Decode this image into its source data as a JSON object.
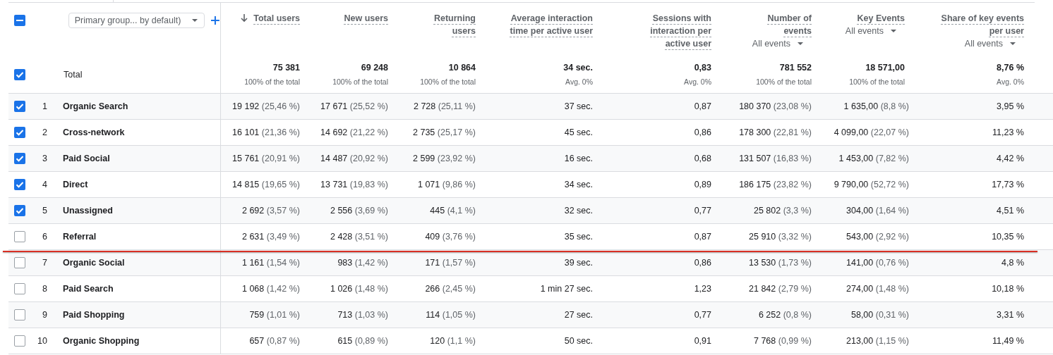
{
  "select_all": {
    "indeterminate": true
  },
  "group_selector": {
    "label": "Primary group... by default)"
  },
  "columns": [
    {
      "label": "Total users",
      "sorted": true
    },
    {
      "label": "New users",
      "sorted": false
    },
    {
      "label": "Returning users",
      "sorted": false
    },
    {
      "label": "Average interaction time per active user",
      "sorted": false
    },
    {
      "label": "Sessions with interaction per active user",
      "sorted": false
    },
    {
      "label": "Number of events",
      "sorted": false,
      "filter": "All events"
    },
    {
      "label": "Key Events",
      "sorted": false,
      "filter": "All events"
    },
    {
      "label": "Share of key events per user",
      "sorted": false,
      "filter": "All events"
    }
  ],
  "totals": {
    "label": "Total",
    "checked": true,
    "values": [
      {
        "value": "75 381",
        "note": "100% of the total"
      },
      {
        "value": "69 248",
        "note": "100% of the total"
      },
      {
        "value": "10 864",
        "note": "100% of the total"
      },
      {
        "value": "34 sec.",
        "note": "Avg. 0%"
      },
      {
        "value": "0,83",
        "note": "Avg. 0%"
      },
      {
        "value": "781 552",
        "note": "100% of the total"
      },
      {
        "value": "18 571,00",
        "note": "100% of the total"
      },
      {
        "value": "8,76 %",
        "note": "Avg. 0%"
      }
    ]
  },
  "rows": [
    {
      "index": "1",
      "name": "Organic Search",
      "checked": true,
      "annotated": false,
      "cells": [
        {
          "value": "19 192",
          "share": "(25,46 %)"
        },
        {
          "value": "17 671",
          "share": "(25,52 %)"
        },
        {
          "value": "2 728",
          "share": "(25,11 %)"
        },
        {
          "value": "37 sec."
        },
        {
          "value": "0,87"
        },
        {
          "value": "180 370",
          "share": "(23,08 %)"
        },
        {
          "value": "1 635,00",
          "share": "(8,8 %)"
        },
        {
          "value": "3,95 %"
        }
      ]
    },
    {
      "index": "2",
      "name": "Cross-network",
      "checked": true,
      "annotated": false,
      "cells": [
        {
          "value": "16 101",
          "share": "(21,36 %)"
        },
        {
          "value": "14 692",
          "share": "(21,22 %)"
        },
        {
          "value": "2 735",
          "share": "(25,17 %)"
        },
        {
          "value": "45 sec."
        },
        {
          "value": "0,86"
        },
        {
          "value": "178 300",
          "share": "(22,81 %)"
        },
        {
          "value": "4 099,00",
          "share": "(22,07 %)"
        },
        {
          "value": "11,23 %"
        }
      ]
    },
    {
      "index": "3",
      "name": "Paid Social",
      "checked": true,
      "annotated": false,
      "cells": [
        {
          "value": "15 761",
          "share": "(20,91 %)"
        },
        {
          "value": "14 487",
          "share": "(20,92 %)"
        },
        {
          "value": "2 599",
          "share": "(23,92 %)"
        },
        {
          "value": "16 sec."
        },
        {
          "value": "0,68"
        },
        {
          "value": "131 507",
          "share": "(16,83 %)"
        },
        {
          "value": "1 453,00",
          "share": "(7,82 %)"
        },
        {
          "value": "4,42 %"
        }
      ]
    },
    {
      "index": "4",
      "name": "Direct",
      "checked": true,
      "annotated": false,
      "cells": [
        {
          "value": "14 815",
          "share": "(19,65 %)"
        },
        {
          "value": "13 731",
          "share": "(19,83 %)"
        },
        {
          "value": "1 071",
          "share": "(9,86 %)"
        },
        {
          "value": "34 sec."
        },
        {
          "value": "0,89"
        },
        {
          "value": "186 175",
          "share": "(23,82 %)"
        },
        {
          "value": "9 790,00",
          "share": "(52,72 %)"
        },
        {
          "value": "17,73 %"
        }
      ]
    },
    {
      "index": "5",
      "name": "Unassigned",
      "checked": true,
      "annotated": false,
      "cells": [
        {
          "value": "2 692",
          "share": "(3,57 %)"
        },
        {
          "value": "2 556",
          "share": "(3,69 %)"
        },
        {
          "value": "445",
          "share": "(4,1 %)"
        },
        {
          "value": "32 sec."
        },
        {
          "value": "0,77"
        },
        {
          "value": "25 802",
          "share": "(3,3 %)"
        },
        {
          "value": "304,00",
          "share": "(1,64 %)"
        },
        {
          "value": "4,51 %"
        }
      ]
    },
    {
      "index": "6",
      "name": "Referral",
      "checked": false,
      "annotated": true,
      "cells": [
        {
          "value": "2 631",
          "share": "(3,49 %)"
        },
        {
          "value": "2 428",
          "share": "(3,51 %)"
        },
        {
          "value": "409",
          "share": "(3,76 %)"
        },
        {
          "value": "35 sec."
        },
        {
          "value": "0,87"
        },
        {
          "value": "25 910",
          "share": "(3,32 %)"
        },
        {
          "value": "543,00",
          "share": "(2,92 %)"
        },
        {
          "value": "10,35 %"
        }
      ]
    },
    {
      "index": "7",
      "name": "Organic Social",
      "checked": false,
      "annotated": false,
      "cells": [
        {
          "value": "1 161",
          "share": "(1,54 %)"
        },
        {
          "value": "983",
          "share": "(1,42 %)"
        },
        {
          "value": "171",
          "share": "(1,57 %)"
        },
        {
          "value": "39 sec."
        },
        {
          "value": "0,86"
        },
        {
          "value": "13 530",
          "share": "(1,73 %)"
        },
        {
          "value": "141,00",
          "share": "(0,76 %)"
        },
        {
          "value": "4,8 %"
        }
      ]
    },
    {
      "index": "8",
      "name": "Paid Search",
      "checked": false,
      "annotated": false,
      "cells": [
        {
          "value": "1 068",
          "share": "(1,42 %)"
        },
        {
          "value": "1 026",
          "share": "(1,48 %)"
        },
        {
          "value": "266",
          "share": "(2,45 %)"
        },
        {
          "value": "1 min 27 sec."
        },
        {
          "value": "1,23"
        },
        {
          "value": "21 842",
          "share": "(2,79 %)"
        },
        {
          "value": "274,00",
          "share": "(1,48 %)"
        },
        {
          "value": "10,18 %"
        }
      ]
    },
    {
      "index": "9",
      "name": "Paid Shopping",
      "checked": false,
      "annotated": false,
      "cells": [
        {
          "value": "759",
          "share": "(1,01 %)"
        },
        {
          "value": "713",
          "share": "(1,03 %)"
        },
        {
          "value": "114",
          "share": "(1,05 %)"
        },
        {
          "value": "27 sec."
        },
        {
          "value": "0,77"
        },
        {
          "value": "6 252",
          "share": "(0,8 %)"
        },
        {
          "value": "58,00",
          "share": "(0,31 %)"
        },
        {
          "value": "3,31 %"
        }
      ]
    },
    {
      "index": "10",
      "name": "Organic Shopping",
      "checked": false,
      "annotated": false,
      "cells": [
        {
          "value": "657",
          "share": "(0,87 %)"
        },
        {
          "value": "615",
          "share": "(0,89 %)"
        },
        {
          "value": "120",
          "share": "(1,1 %)"
        },
        {
          "value": "50 sec."
        },
        {
          "value": "0,91"
        },
        {
          "value": "7 768",
          "share": "(0,99 %)"
        },
        {
          "value": "213,00",
          "share": "(1,15 %)"
        },
        {
          "value": "11,49 %"
        }
      ]
    }
  ]
}
